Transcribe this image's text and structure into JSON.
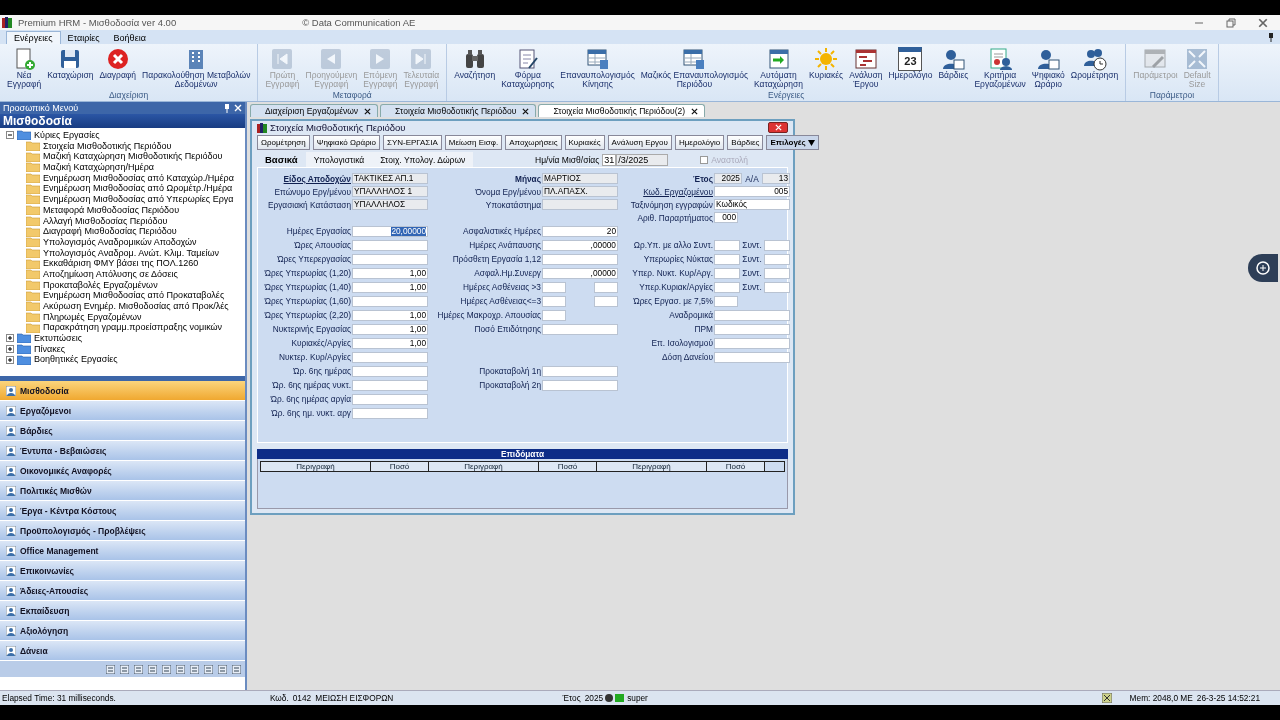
{
  "window": {
    "title": "Premium HRM - Μισθοδοσία ver 4.00",
    "copyright": "© Data Communication AE"
  },
  "ribbon_tabs": [
    {
      "label": "Ενέργειες",
      "selected": true
    },
    {
      "label": "Εταιρίες",
      "selected": false
    },
    {
      "label": "Βοήθεια",
      "selected": false
    }
  ],
  "ribbon_groups": [
    {
      "label": "Διαχείριση",
      "buttons": [
        {
          "label": "Νέα\nΕγγραφή",
          "kind": "new",
          "disabled": false
        },
        {
          "label": "Καταχώριση",
          "kind": "save",
          "disabled": false
        },
        {
          "label": "Διαγραφή",
          "kind": "delete",
          "disabled": false
        },
        {
          "label": "Παρακολούθηση Μεταβολών\nΔεδομένων",
          "kind": "building",
          "disabled": false
        }
      ]
    },
    {
      "label": "Μεταφορά",
      "buttons": [
        {
          "label": "Πρώτη\nΕγγραφή",
          "kind": "first",
          "disabled": true
        },
        {
          "label": "Προηγούμενη\nΕγγραφή",
          "kind": "prev",
          "disabled": true
        },
        {
          "label": "Επόμενη\nΕγγραφή",
          "kind": "next",
          "disabled": true
        },
        {
          "label": "Τελευταία\nΕγγραφή",
          "kind": "last",
          "disabled": true
        }
      ]
    },
    {
      "label": "Ενέργειες",
      "buttons": [
        {
          "label": "Αναζήτηση",
          "kind": "search",
          "disabled": false
        },
        {
          "label": "Φόρμα\nΚαταχώρησης",
          "kind": "form",
          "disabled": false
        },
        {
          "label": "Επαναυπολογισμός\nΚίνησης",
          "kind": "sheet",
          "disabled": false
        },
        {
          "label": "Μαζικός Επαναυπολογισμός\nΠεριόδου",
          "kind": "sheet",
          "disabled": false
        },
        {
          "label": "Αυτόματη\nΚαταχώρηση",
          "kind": "auto",
          "disabled": false
        },
        {
          "label": "Κυριακές",
          "kind": "sun",
          "disabled": false
        },
        {
          "label": "Ανάλυση\nΈργου",
          "kind": "gantt",
          "disabled": false
        },
        {
          "label": "Ημερολόγιο",
          "kind": "calendar",
          "icon_text": "23",
          "disabled": false
        },
        {
          "label": "Βάρδιες",
          "kind": "worker",
          "disabled": false
        },
        {
          "label": "Κριτήρια\nΕργαζομένων",
          "kind": "cert",
          "disabled": false
        },
        {
          "label": "Ψηφιακό\nΩράριο",
          "kind": "worker",
          "disabled": false
        },
        {
          "label": "Ωρομέτρηση",
          "kind": "people",
          "disabled": false
        }
      ]
    },
    {
      "label": "Παράμετροι",
      "buttons": [
        {
          "label": "Παράμετροι",
          "kind": "params",
          "disabled": true
        },
        {
          "label": "Default\nSize",
          "kind": "expand",
          "disabled": true
        }
      ]
    }
  ],
  "sidebar": {
    "header": "Προσωπικό Μενού",
    "title": "Μισθοδοσία",
    "tree": [
      {
        "label": "Κύριες Εργασίες",
        "expanded": true,
        "children": [
          {
            "label": "Στοιχεία Μισθοδοτικής Περιόδου"
          },
          {
            "label": "Μαζική Καταχώρηση Μισθοδοτικής Περιόδου"
          },
          {
            "label": "Μαζική Καταχώρηση/Ημέρα"
          },
          {
            "label": "Ενημέρωση Μισθοδοσίας από Καταχώρ./Ημέρα"
          },
          {
            "label": "Ενημέρωση Μισθοδοσίας από Ωρομέτρ./Ημέρα"
          },
          {
            "label": "Ενημέρωση Μισθοδοσίας από Υπερωρίες Εργα"
          },
          {
            "label": "Μεταφορά Μισθοδοσίας Περιόδου"
          },
          {
            "label": "Αλλαγή Μισθοδοσίας Περιόδου"
          },
          {
            "label": "Διαγραφή Μισθοδοσίας Περιόδου"
          },
          {
            "label": "Υπολογισμός Αναδρομικών Αποδοχών"
          },
          {
            "label": "Υπολογισμός Αναδρομ. Ανώτ. Κλιμ. Ταμείων"
          },
          {
            "label": "Εκκαθάριση ΦΜΥ βάσει της ΠΟΛ.1260"
          },
          {
            "label": "Αποζημίωση Απόλυσης σε Δόσεις"
          },
          {
            "label": "Προκαταβολές Εργαζομένων"
          },
          {
            "label": "Ενημέρωση Μισθοδοσίας από Προκαταβολές"
          },
          {
            "label": "Ακύρωση Ενημέρ. Μισθοδοσίας από Προκ/λές"
          },
          {
            "label": "Πληρωμές Εργαζομένων"
          },
          {
            "label": "Παρακράτηση γραμμ.προείσπραξης νομικών"
          }
        ]
      },
      {
        "label": "Εκτυπώσεις",
        "expanded": false
      },
      {
        "label": "Πίνακες",
        "expanded": false
      },
      {
        "label": "Βοηθητικές Εργασίες",
        "expanded": false
      }
    ],
    "nav": [
      {
        "label": "Μισθοδοσία",
        "selected": true
      },
      {
        "label": "Εργαζόμενοι",
        "selected": false
      },
      {
        "label": "Βάρδιες",
        "selected": false
      },
      {
        "label": "Έντυπα - Βεβαιώσεις",
        "selected": false
      },
      {
        "label": "Οικονομικές Αναφορές",
        "selected": false
      },
      {
        "label": "Πολιτικές Μισθών",
        "selected": false
      },
      {
        "label": "Έργα - Κέντρα Κόστους",
        "selected": false
      },
      {
        "label": "Προϋπολογισμός - Προβλέψεις",
        "selected": false
      },
      {
        "label": "Office Management",
        "selected": false
      },
      {
        "label": "Επικοινωνίες",
        "selected": false
      },
      {
        "label": "Άδειες-Απουσίες",
        "selected": false
      },
      {
        "label": "Εκπαίδευση",
        "selected": false
      },
      {
        "label": "Αξιολόγηση",
        "selected": false
      },
      {
        "label": "Δάνεια",
        "selected": false
      }
    ]
  },
  "doc_tabs": [
    {
      "label": "Διαχείριση Εργαζομένων",
      "selected": false
    },
    {
      "label": "Στοιχεία Μισθοδοτικής Περιόδου",
      "selected": false
    },
    {
      "label": "Στοιχεία Μισθοδοτικής Περιόδου(2)",
      "selected": true
    }
  ],
  "form": {
    "title": "Στοιχεία Μισθοδοτικής Περιόδου",
    "buttons": [
      {
        "label": "Ωρομέτρηση",
        "kind": "button"
      },
      {
        "label": "Ψηφιακό Ωράριο",
        "kind": "button"
      },
      {
        "label": "ΣΥΝ-ΕΡΓΑΣΙΑ",
        "kind": "button"
      },
      {
        "label": "Μείωση Εισφ.",
        "kind": "button"
      },
      {
        "label": "Αποχωρήσεις",
        "kind": "button"
      },
      {
        "label": "Κυριακές",
        "kind": "button"
      },
      {
        "label": "Ανάλυση Εργου",
        "kind": "button"
      },
      {
        "label": "Ημερολόγιο",
        "kind": "button"
      },
      {
        "label": "Βάρδιες",
        "kind": "button"
      },
      {
        "label": "Επιλογές",
        "kind": "dropdown"
      }
    ],
    "subtabs": [
      {
        "label": "Βασικά",
        "selected": true
      },
      {
        "label": "Υπολογιστικά",
        "selected": false
      },
      {
        "label": "Στοιχ. Υπολογ. Δώρων",
        "selected": false
      }
    ],
    "date": {
      "label": "Ημ/νία Μισθ/σίας",
      "day": "31",
      "rest": "/3/2025"
    },
    "suspend": {
      "label": "Αναστολή",
      "checked": false,
      "disabled": true
    },
    "columns": [
      {
        "header": [
          {
            "kind": "full",
            "label": "Είδος Αποδοχών",
            "link": true,
            "heading": true,
            "fields": [
              {
                "value": "ΤΑΚΤΙΚΕΣ ΑΠ.1",
                "readonly": true
              }
            ]
          },
          {
            "kind": "full",
            "label": "Επώνυμο Εργ/μένου",
            "link": false,
            "heading": false,
            "fields": [
              {
                "value": "ΥΠΑΛΛΗΛΟΣ 1",
                "readonly": true
              }
            ]
          },
          {
            "kind": "full",
            "label": "Εργασιακή Κατάσταση",
            "link": false,
            "heading": false,
            "fields": [
              {
                "value": "ΥΠΑΛΛΗΛΟΣ",
                "readonly": true
              }
            ]
          }
        ],
        "main": [
          {
            "kind": "full",
            "label": "Ημέρες Εργασίας",
            "link": false,
            "heading": false,
            "fields": [
              {
                "value": "20,00000",
                "readonly": false,
                "highlighted": true
              }
            ]
          },
          {
            "kind": "full",
            "label": "Ώρες Απουσίας",
            "link": false,
            "heading": false,
            "fields": [
              {
                "readonly": false
              }
            ]
          },
          {
            "kind": "full",
            "label": "Ώρες Υπερεργασίας",
            "link": false,
            "heading": false,
            "fields": [
              {
                "readonly": false
              }
            ]
          },
          {
            "kind": "full",
            "label": "Ώρες Υπερωρίας (1,20)",
            "link": false,
            "heading": false,
            "fields": [
              {
                "value": "1,00",
                "readonly": false
              }
            ]
          },
          {
            "kind": "full",
            "label": "Ώρες Υπερωρίας (1,40)",
            "link": false,
            "heading": false,
            "fields": [
              {
                "value": "1,00",
                "readonly": false
              }
            ]
          },
          {
            "kind": "full",
            "label": "Ώρες Υπερωρίας (1,60)",
            "link": false,
            "heading": false,
            "fields": [
              {
                "readonly": false
              }
            ]
          },
          {
            "kind": "full",
            "label": "Ώρες Υπερωρίας (2,20)",
            "link": false,
            "heading": false,
            "fields": [
              {
                "value": "1,00",
                "readonly": false
              }
            ]
          },
          {
            "kind": "full",
            "label": "Νυκτερινής Εργασίας",
            "link": false,
            "heading": false,
            "fields": [
              {
                "value": "1,00",
                "readonly": false
              }
            ]
          },
          {
            "kind": "full",
            "label": "Κυριακές/Αργίες",
            "link": false,
            "heading": false,
            "fields": [
              {
                "value": "1,00",
                "readonly": false
              }
            ]
          },
          {
            "kind": "full",
            "label": "Νυκτερ. Κυρ/Αργίες",
            "link": false,
            "heading": false,
            "fields": [
              {
                "readonly": false
              }
            ]
          },
          {
            "kind": "full",
            "label": "Ώρ. 6ης ημέρας",
            "link": false,
            "heading": false,
            "fields": [
              {
                "readonly": false
              }
            ]
          },
          {
            "kind": "full",
            "label": "Ώρ. 6ης ημέρας νυκτ.",
            "link": false,
            "heading": false,
            "fields": [
              {
                "readonly": false
              }
            ]
          },
          {
            "kind": "full",
            "label": "Ώρ. 6ης ημέρας αργία",
            "link": false,
            "heading": false,
            "fields": [
              {
                "readonly": false
              }
            ]
          },
          {
            "kind": "full",
            "label": "Ώρ. 6ης ημ. νυκτ. αργ",
            "link": false,
            "heading": false,
            "fields": [
              {
                "readonly": false
              }
            ]
          }
        ]
      },
      {
        "header": [
          {
            "kind": "full",
            "label": "Μήνας",
            "link": false,
            "heading": true,
            "fields": [
              {
                "value": "ΜΑΡΤΙΟΣ",
                "readonly": true
              }
            ]
          },
          {
            "kind": "full",
            "label": "Όνομα Εργ/μένου",
            "link": false,
            "heading": false,
            "fields": [
              {
                "value": "ΠΛ.ΑΠΑΣΧ.",
                "readonly": true
              }
            ]
          },
          {
            "kind": "full",
            "label": "Υποκατάστημα",
            "link": false,
            "heading": false,
            "fields": [
              {
                "readonly": true
              }
            ]
          }
        ],
        "main": [
          {
            "kind": "full",
            "label": "Ασφαλιστικές Ημέρες",
            "link": false,
            "heading": false,
            "fields": [
              {
                "value": "20",
                "readonly": false
              }
            ]
          },
          {
            "kind": "full",
            "label": "Ημέρες Ανάπαυσης",
            "link": false,
            "heading": false,
            "fields": [
              {
                "value": ",00000",
                "readonly": false
              }
            ]
          },
          {
            "kind": "full",
            "label": "Πρόσθετη Εργασία 1,12",
            "link": false,
            "heading": false,
            "fields": [
              {
                "readonly": false
              }
            ]
          },
          {
            "kind": "full",
            "label": "Ασφαλ.Ημ.Συνεργ",
            "link": false,
            "heading": false,
            "fields": [
              {
                "value": ",00000",
                "readonly": false
              }
            ]
          },
          {
            "kind": "pair",
            "label": "Ημέρες Ασθένειας >3",
            "link": false,
            "heading": false,
            "fields": [
              {
                "readonly": false
              },
              {
                "readonly": false
              }
            ]
          },
          {
            "kind": "pair",
            "label": "Ημέρες Ασθένειας<=3",
            "link": false,
            "heading": false,
            "fields": [
              {
                "readonly": false
              },
              {
                "readonly": false
              }
            ]
          },
          {
            "kind": "small",
            "label": "Ημέρες Μακροχρ. Απουσίας",
            "link": false,
            "heading": false,
            "fields": [
              {
                "readonly": false
              }
            ]
          },
          {
            "kind": "full",
            "label": "Ποσό Επιδότησης",
            "link": false,
            "heading": false,
            "fields": [
              {
                "readonly": false
              }
            ]
          },
          {
            "kind": "gap"
          },
          {
            "kind": "gap"
          },
          {
            "kind": "full",
            "label": "Προκαταβολή 1η",
            "link": false,
            "heading": false,
            "fields": [
              {
                "readonly": false
              }
            ]
          },
          {
            "kind": "full",
            "label": "Προκαταβολή 2η",
            "link": false,
            "heading": false,
            "fields": [
              {
                "readonly": false
              }
            ]
          }
        ]
      },
      {
        "header": [
          {
            "kind": "sub",
            "label": "Έτος",
            "link": false,
            "heading": true,
            "sublabel": "Α/Α",
            "fields": [
              {
                "value": "2025",
                "readonly": true
              },
              {
                "value": "13",
                "readonly": true
              }
            ]
          },
          {
            "kind": "full",
            "label": "Κωδ. Εργαζομένου",
            "link": true,
            "heading": false,
            "fields": [
              {
                "value": "005",
                "readonly": false
              }
            ]
          },
          {
            "kind": "full",
            "label": "Ταξινόμηση εγγραφών",
            "link": false,
            "heading": false,
            "fields": [
              {
                "value": "Κωδικός",
                "readonly": false
              }
            ]
          },
          {
            "kind": "small",
            "label": "Αριθ. Παραρτήματος",
            "link": false,
            "heading": false,
            "fields": [
              {
                "value": "000",
                "readonly": false
              }
            ]
          }
        ],
        "main": [
          {
            "kind": "gap"
          },
          {
            "kind": "sub",
            "label": "Ωρ.Υπ. με αλλο Συντ.",
            "link": false,
            "heading": false,
            "sublabel": "Συντ.",
            "fields": [
              {
                "readonly": false
              },
              {
                "readonly": false
              }
            ]
          },
          {
            "kind": "sub",
            "label": "Υπερωρίες Νύκτας",
            "link": false,
            "heading": false,
            "sublabel": "Συντ.",
            "fields": [
              {
                "readonly": false
              },
              {
                "readonly": false
              }
            ]
          },
          {
            "kind": "sub",
            "label": "Υπερ. Νυκτ. Κυρ/Αργ.",
            "link": false,
            "heading": false,
            "sublabel": "Συντ.",
            "fields": [
              {
                "readonly": false
              },
              {
                "readonly": false
              }
            ]
          },
          {
            "kind": "sub",
            "label": "Υπερ.Κυριακ/Αργίες",
            "link": false,
            "heading": false,
            "sublabel": "Συντ.",
            "fields": [
              {
                "readonly": false
              },
              {
                "readonly": false
              }
            ]
          },
          {
            "kind": "small",
            "label": "Ώρες Εργασ. με 7,5%",
            "link": false,
            "heading": false,
            "fields": [
              {
                "readonly": false
              }
            ]
          },
          {
            "kind": "full",
            "label": "Αναδρομικά",
            "link": false,
            "heading": false,
            "fields": [
              {
                "readonly": false
              }
            ]
          },
          {
            "kind": "full",
            "label": "ΠΡΜ",
            "link": false,
            "heading": false,
            "fields": [
              {
                "readonly": false
              }
            ]
          },
          {
            "kind": "full",
            "label": "Επ. Ισολογισμού",
            "link": false,
            "heading": false,
            "fields": [
              {
                "readonly": false
              }
            ]
          },
          {
            "kind": "full",
            "label": "Δόση Δανείου",
            "link": false,
            "heading": false,
            "fields": [
              {
                "readonly": false
              }
            ]
          }
        ]
      }
    ],
    "table": {
      "title": "Επιδόματα",
      "columns": [
        "Περιγραφή",
        "Ποσό",
        "Περιγραφή",
        "Ποσό",
        "Περιγραφή",
        "Ποσό"
      ]
    }
  },
  "status_bar": {
    "elapsed": "Elapsed Time: 31 milliseconds.",
    "code_label": "Κωδ.",
    "code": "0142",
    "code_name": "ΜΕΙΩΣΗ ΕΙΣΦΟΡΩΝ",
    "year_label": "Έτος",
    "year": "2025",
    "user": "super",
    "memory": "Mem: 2048,0 ΜΕ",
    "datetime": "26-3-25 14:52:21"
  }
}
